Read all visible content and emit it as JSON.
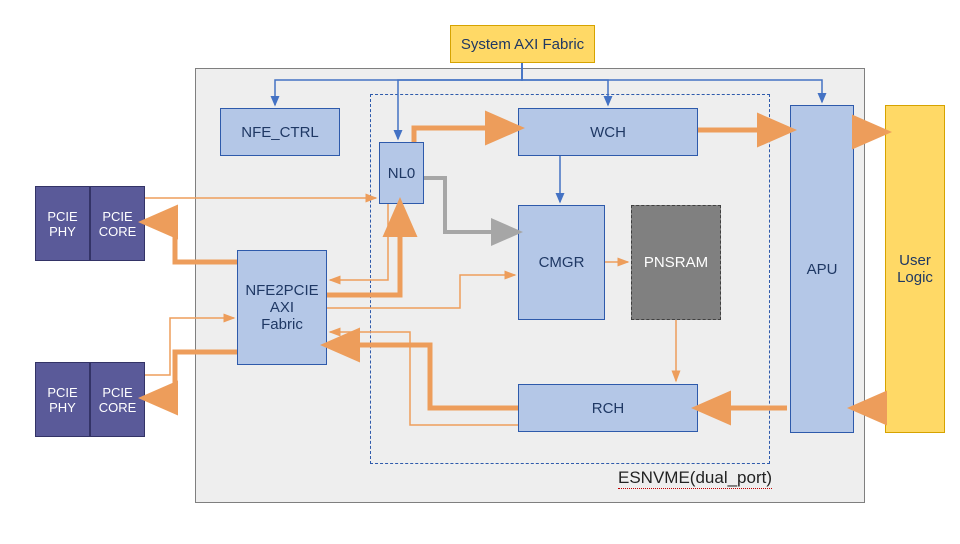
{
  "chart_data": {
    "type": "diagram",
    "title": "ESNVME(dual_port)",
    "nodes": [
      {
        "id": "sys_axi",
        "label": "System AXI Fabric",
        "kind": "external"
      },
      {
        "id": "nfe_ctrl",
        "label": "NFE_CTRL",
        "kind": "block"
      },
      {
        "id": "nl0",
        "label": "NL0",
        "kind": "block"
      },
      {
        "id": "wch",
        "label": "WCH",
        "kind": "block"
      },
      {
        "id": "cmgr",
        "label": "CMGR",
        "kind": "block"
      },
      {
        "id": "pnsram",
        "label": "PNSRAM",
        "kind": "memory"
      },
      {
        "id": "rch",
        "label": "RCH",
        "kind": "block"
      },
      {
        "id": "apu",
        "label": "APU",
        "kind": "block"
      },
      {
        "id": "nfe2pcie",
        "label": "NFE2PCIE AXI Fabric",
        "kind": "block"
      },
      {
        "id": "pcie_phy_0",
        "label": "PCIE PHY",
        "kind": "phy"
      },
      {
        "id": "pcie_core_0",
        "label": "PCIE CORE",
        "kind": "phy"
      },
      {
        "id": "pcie_phy_1",
        "label": "PCIE PHY",
        "kind": "phy"
      },
      {
        "id": "pcie_core_1",
        "label": "PCIE CORE",
        "kind": "phy"
      },
      {
        "id": "user_logic",
        "label": "User Logic",
        "kind": "external"
      }
    ],
    "edges": [
      {
        "from": "sys_axi",
        "to": "nfe_ctrl",
        "style": "ctrl"
      },
      {
        "from": "sys_axi",
        "to": "nl0",
        "style": "ctrl"
      },
      {
        "from": "sys_axi",
        "to": "wch",
        "style": "ctrl"
      },
      {
        "from": "sys_axi",
        "to": "apu",
        "style": "ctrl"
      },
      {
        "from": "nl0",
        "to": "wch",
        "style": "data"
      },
      {
        "from": "nl0",
        "to": "cmgr",
        "style": "ctrl_gray"
      },
      {
        "from": "wch",
        "to": "cmgr",
        "style": "ctrl"
      },
      {
        "from": "cmgr",
        "to": "pnsram",
        "style": "data"
      },
      {
        "from": "pnsram",
        "to": "rch",
        "style": "data"
      },
      {
        "from": "wch",
        "to": "apu",
        "style": "data"
      },
      {
        "from": "apu",
        "to": "rch",
        "style": "data"
      },
      {
        "from": "apu",
        "to": "user_logic",
        "style": "data_bi"
      },
      {
        "from": "user_logic",
        "to": "apu",
        "style": "data"
      },
      {
        "from": "rch",
        "to": "nfe2pcie",
        "style": "data"
      },
      {
        "from": "nfe2pcie",
        "to": "nl0",
        "style": "data"
      },
      {
        "from": "nl0",
        "to": "nfe2pcie",
        "style": "data_thin"
      },
      {
        "from": "cmgr",
        "to": "nfe2pcie",
        "style": "data_thin"
      },
      {
        "from": "rch",
        "to": "nfe2pcie",
        "style": "data_thin"
      },
      {
        "from": "nfe2pcie",
        "to": "pcie_core_0",
        "style": "data"
      },
      {
        "from": "nfe2pcie",
        "to": "pcie_core_1",
        "style": "data"
      },
      {
        "from": "pcie_core_0",
        "to": "nl0",
        "style": "data_thin"
      },
      {
        "from": "pcie_core_1",
        "to": "nfe2pcie",
        "style": "data_thin"
      }
    ],
    "groups": [
      {
        "id": "esnvme",
        "label": "ESNVME(dual_port)",
        "members": [
          "nfe_ctrl",
          "nl0",
          "wch",
          "cmgr",
          "pnsram",
          "rch",
          "apu",
          "nfe2pcie"
        ]
      },
      {
        "id": "inner_dashed",
        "members": [
          "nl0",
          "wch",
          "cmgr",
          "pnsram",
          "rch"
        ]
      }
    ]
  },
  "blocks": {
    "sys_axi": "System AXI Fabric",
    "nfe_ctrl": "NFE_CTRL",
    "nl0": "NL0",
    "wch": "WCH",
    "cmgr": "CMGR",
    "pnsram": "PNSRAM",
    "rch": "RCH",
    "apu": "APU",
    "user_logic": "User Logic",
    "nfe2pcie": "NFE2PCIE\nAXI\nFabric",
    "pcie_phy": "PCIE\nPHY",
    "pcie_core": "PCIE\nCORE",
    "frame_label": "ESNVME(dual_port)"
  }
}
